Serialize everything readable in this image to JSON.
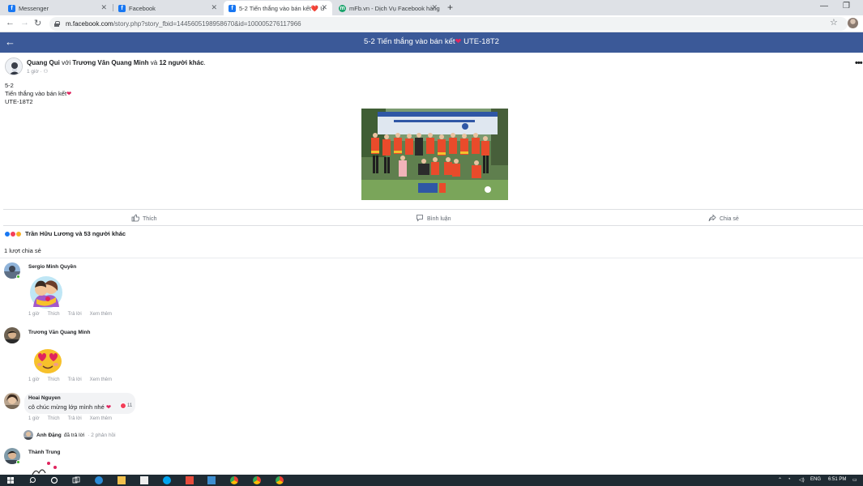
{
  "browser": {
    "tabs": [
      {
        "title": "Messenger",
        "favicon": "facebook-icon"
      },
      {
        "title": "Facebook",
        "favicon": "facebook-icon"
      },
      {
        "title": "5-2 Tiến thắng vào bán kết❤️ U",
        "favicon": "facebook-icon",
        "active": true
      },
      {
        "title": "mFb.vn - Dịch Vụ Facebook hàng",
        "favicon": "mfb-icon"
      }
    ],
    "url_host": "m.facebook.com",
    "url_path": "/story.php?story_fbid=1445605198958670&id=100005276117966"
  },
  "header": {
    "title": "5-2 Tiến thắng vào bán kết",
    "title_suffix": "UTE-18T2"
  },
  "post": {
    "author": "Quang Qui",
    "with_word": "với",
    "tagged": "Trương Văn Quang Minh",
    "and_word": "và",
    "others": "12 người khác",
    "dot": ".",
    "time": "1 giờ · ",
    "text_line1": "5-2",
    "text_line2": "Tiến thắng vào bán kết",
    "text_line3": "UTE-18T2"
  },
  "actions": {
    "like": "Thích",
    "comment": "Bình luận",
    "share": "Chia sẻ"
  },
  "reactions": {
    "text": "Trần Hữu Lương và 53 người khác"
  },
  "shares": "1 lượt chia sẻ",
  "comments": [
    {
      "name": "Sergio Minh Quyền",
      "time": "1 giờ",
      "like": "Thích",
      "reply": "Trả lời",
      "more": "Xem thêm"
    },
    {
      "name": "Trương Văn Quang Minh",
      "time": "1 giờ",
      "like": "Thích",
      "reply": "Trả lời",
      "more": "Xem thêm"
    },
    {
      "name": "Hoai Nguyen",
      "text": "cô chúc mừng lớp mình nhé",
      "reaction_count": "11",
      "time": "1 giờ",
      "like": "Thích",
      "reply": "Trả lời",
      "more": "Xem thêm"
    },
    {
      "name": "Thành Trung"
    }
  ],
  "reply_preview": {
    "name": "Anh Đặng",
    "action": "đã trả lời",
    "count": "· 2 phản hồi"
  },
  "taskbar": {
    "lang": "ENG",
    "time": "6:51 PM"
  },
  "colors": {
    "fb_blue": "#3b5998",
    "online": "#42b72a",
    "heart": "#e0245e"
  }
}
